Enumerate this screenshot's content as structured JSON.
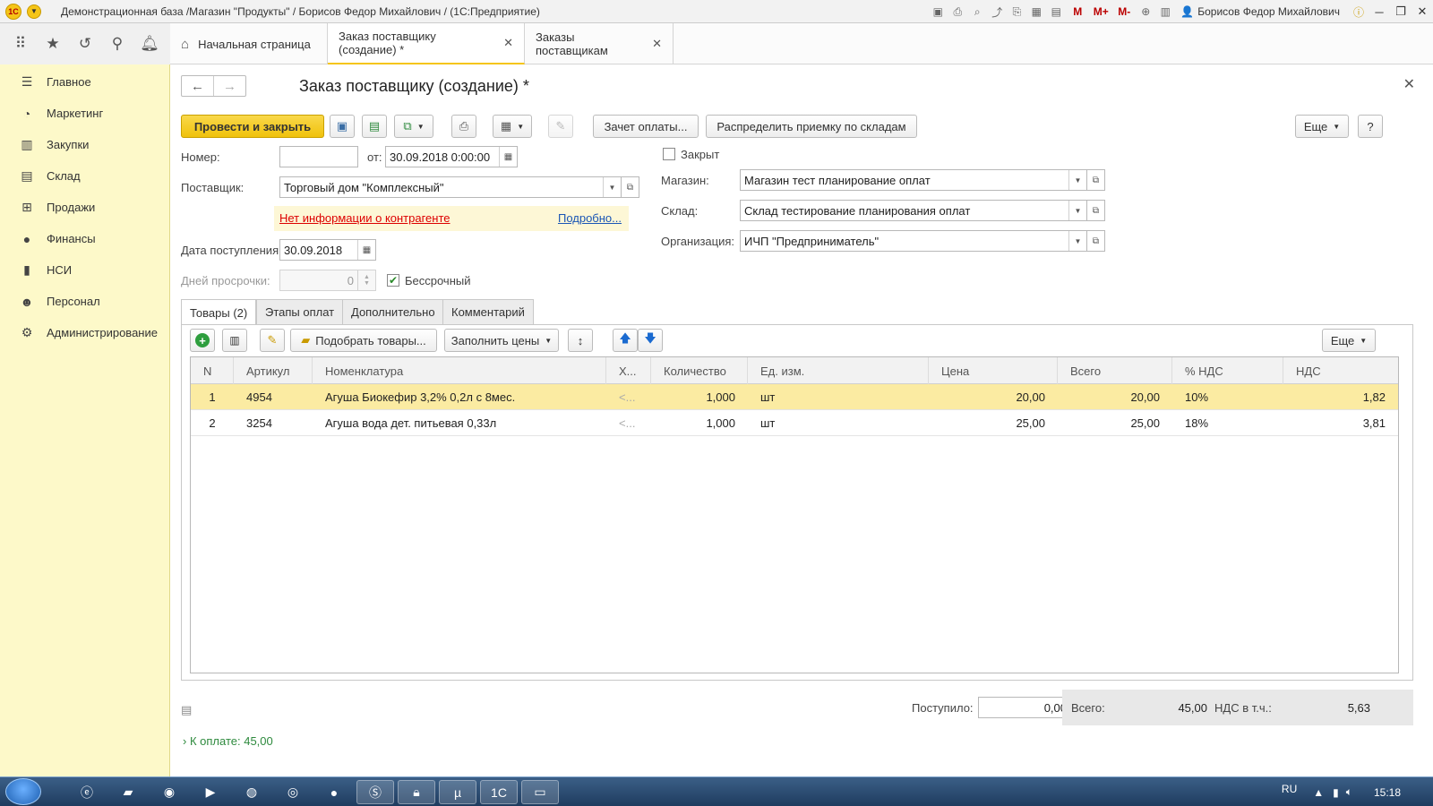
{
  "window": {
    "title": "Демонстрационная база /Магазин \"Продукты\" / Борисов Федор Михайлович /  (1С:Предприятие)",
    "logo_text": "1С",
    "user": "Борисов Федор Михайлович",
    "m_buttons": [
      "M",
      "M+",
      "M-"
    ]
  },
  "tabs": [
    {
      "label": "Начальная страница",
      "icon": "home-icon"
    },
    {
      "label": "Заказ поставщику (создание) *",
      "closable": true,
      "active": true
    },
    {
      "label": "Заказы поставщикам",
      "closable": true
    }
  ],
  "sidebar": {
    "items": [
      {
        "label": "Главное",
        "icon": "menu-lines-icon"
      },
      {
        "label": "Маркетинг",
        "icon": "pie-chart-icon"
      },
      {
        "label": "Закупки",
        "icon": "purchases-icon"
      },
      {
        "label": "Склад",
        "icon": "warehouse-icon"
      },
      {
        "label": "Продажи",
        "icon": "basket-icon"
      },
      {
        "label": "Финансы",
        "icon": "coin-icon"
      },
      {
        "label": "НСИ",
        "icon": "book-icon"
      },
      {
        "label": "Персонал",
        "icon": "person-icon"
      },
      {
        "label": "Администрирование",
        "icon": "gear-icon"
      }
    ]
  },
  "form": {
    "title": "Заказ поставщику (создание) *",
    "toolbar": {
      "post_close": "Провести и закрыть",
      "payment_offset": "Зачет оплаты...",
      "distribute": "Распределить приемку по складам",
      "more": "Еще",
      "help": "?"
    },
    "number_label": "Номер:",
    "number_value": "",
    "from_label": "от:",
    "date_value": "30.09.2018  0:00:00",
    "supplier_label": "Поставщик:",
    "supplier_value": "Торговый дом \"Комплексный\"",
    "warning_text": "Нет информации о контрагенте",
    "details_link": "Подробно...",
    "arrival_label": "Дата поступления:",
    "arrival_value": "30.09.2018",
    "overdue_label": "Дней просрочки:",
    "overdue_value": "0",
    "unlimited_label": "Бессрочный",
    "unlimited_checked": true,
    "closed_label": "Закрыт",
    "closed_checked": false,
    "store_label": "Магазин:",
    "store_value": "Магазин тест планирование оплат",
    "warehouse_label": "Склад:",
    "warehouse_value": "Склад тестирование планирования оплат",
    "org_label": "Организация:",
    "org_value": "ИЧП \"Предприниматель\""
  },
  "form_tabs": [
    "Товары (2)",
    "Этапы оплат",
    "Дополнительно",
    "Комментарий"
  ],
  "goods_toolbar": {
    "pick": "Подобрать товары...",
    "fill_prices": "Заполнить цены",
    "more": "Еще"
  },
  "table": {
    "columns": [
      "N",
      "Артикул",
      "Номенклатура",
      "Х...",
      "Количество",
      "Ед. изм.",
      "Цена",
      "Всего",
      "% НДС",
      "НДС"
    ],
    "rows": [
      {
        "n": "1",
        "article": "4954",
        "name": "Агуша Биокефир 3,2% 0,2л с 8мес.",
        "char": "<...",
        "qty": "1,000",
        "unit": "шт",
        "price": "20,00",
        "total": "20,00",
        "vat_rate": "10%",
        "vat": "1,82",
        "selected": true
      },
      {
        "n": "2",
        "article": "3254",
        "name": "Агуша вода дет. питьевая 0,33л",
        "char": "<...",
        "qty": "1,000",
        "unit": "шт",
        "price": "25,00",
        "total": "25,00",
        "vat_rate": "18%",
        "vat": "3,81",
        "selected": false
      }
    ]
  },
  "totals": {
    "received_label": "Поступило:",
    "received_value": "0,00",
    "total_label": "Всего:",
    "total_value": "45,00",
    "vat_label": "НДС в т.ч.:",
    "vat_value": "5,63"
  },
  "to_pay": "К оплате: 45,00",
  "taskbar": {
    "lang": "RU",
    "time": "15:18",
    "apps": [
      "ie-icon",
      "explorer-icon",
      "app-icon",
      "media-icon",
      "firefox-icon",
      "chrome-icon",
      "yandex-icon",
      "skype-icon",
      "lock-icon",
      "torrent-icon",
      "1c-icon",
      "window-icon"
    ]
  },
  "colors": {
    "accent": "#f5c518",
    "sidebar_bg": "#fdf9c9",
    "selected_row": "#fbeba2",
    "warning_text": "#dd0000",
    "link": "#1a55b5"
  }
}
